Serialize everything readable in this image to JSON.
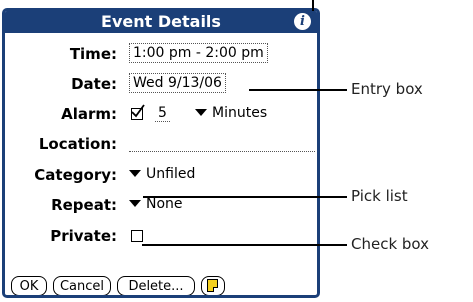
{
  "dialog": {
    "title": "Event Details",
    "time_label": "Time:",
    "time_value": "1:00 pm - 2:00 pm",
    "date_label": "Date:",
    "date_value": "Wed 9/13/06",
    "alarm_label": "Alarm:",
    "alarm_checked": true,
    "alarm_amount": "5",
    "alarm_unit": "Minutes",
    "location_label": "Location:",
    "location_value": "",
    "category_label": "Category:",
    "category_value": "Unfiled",
    "repeat_label": "Repeat:",
    "repeat_value": "None",
    "private_label": "Private:",
    "private_checked": false
  },
  "buttons": {
    "ok": "OK",
    "cancel": "Cancel",
    "delete": "Delete...",
    "note_icon": "note-icon"
  },
  "callouts": {
    "entry_box": "Entry box",
    "pick_list": "Pick list",
    "check_box": "Check box"
  },
  "colors": {
    "title_bar": "#1b3f78",
    "note": "#f4d020"
  }
}
